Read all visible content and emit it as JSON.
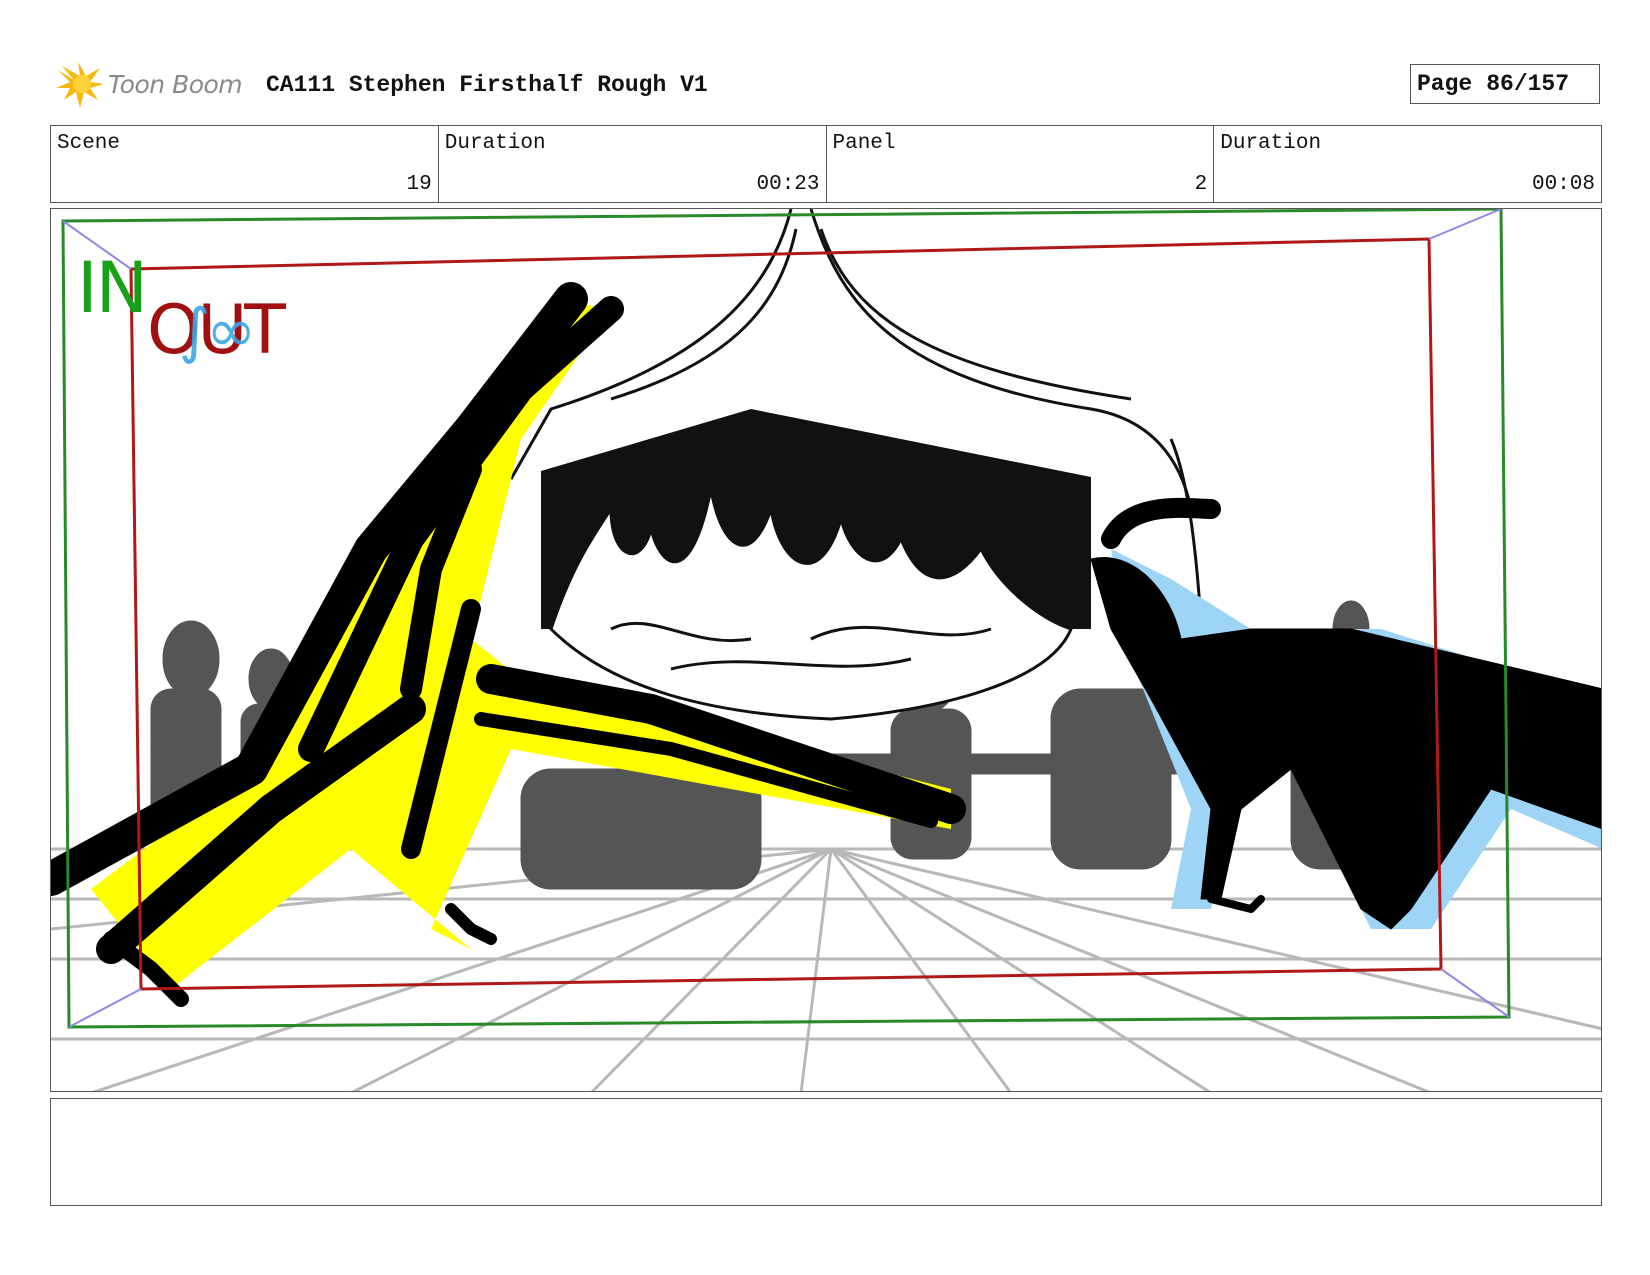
{
  "header": {
    "logo_text": "Toon Boom",
    "title": "CA111 Stephen Firsthalf Rough V1",
    "page_label": "Page",
    "page_value": "86/157"
  },
  "info": {
    "scene_label": "Scene",
    "scene_value": "19",
    "duration_label": "Duration",
    "duration_value": "00:23",
    "panel_label": "Panel",
    "panel_value": "2",
    "panel_duration_label": "Duration",
    "panel_duration_value": "00:08"
  },
  "panel_art": {
    "in_tag": "IN",
    "out_tag": "OUT",
    "colors": {
      "in_frame": "#2a8a2a",
      "out_frame": "#b01818",
      "highlight_yellow": "#ffff00",
      "highlight_blue": "#9ed4f5",
      "crowd_gray": "#555555"
    }
  },
  "notes": {
    "text": ""
  }
}
